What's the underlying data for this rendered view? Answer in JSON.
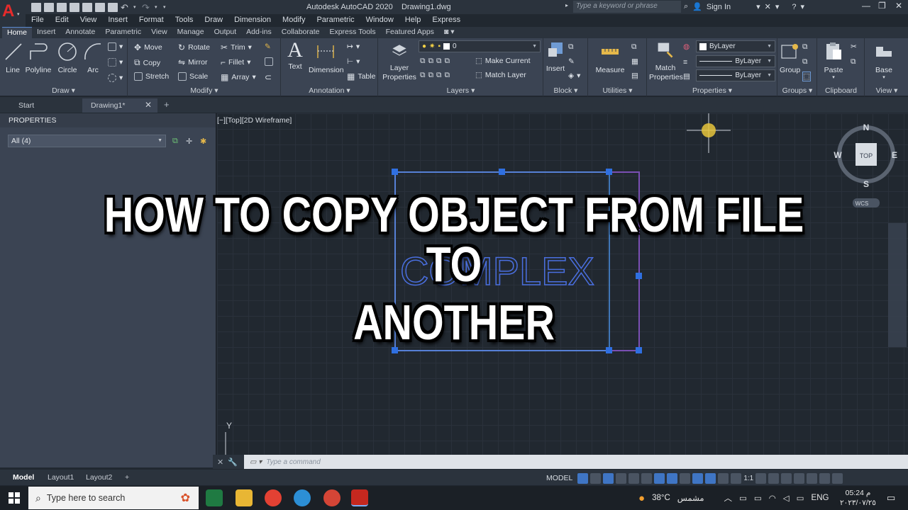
{
  "window": {
    "title": "Autodesk AutoCAD 2020",
    "filename": "Drawing1.dwg",
    "search_placeholder": "Type a keyword or phrase",
    "signin": "Sign In"
  },
  "menubar": [
    "File",
    "Edit",
    "View",
    "Insert",
    "Format",
    "Tools",
    "Draw",
    "Dimension",
    "Modify",
    "Parametric",
    "Window",
    "Help",
    "Express"
  ],
  "ribbon_tabs": [
    "Home",
    "Insert",
    "Annotate",
    "Parametric",
    "View",
    "Manage",
    "Output",
    "Add-ins",
    "Collaborate",
    "Express Tools",
    "Featured Apps"
  ],
  "ribbon": {
    "draw": {
      "label": "Draw",
      "line": "Line",
      "polyline": "Polyline",
      "circle": "Circle",
      "arc": "Arc"
    },
    "modify": {
      "label": "Modify",
      "move": "Move",
      "rotate": "Rotate",
      "trim": "Trim",
      "copy": "Copy",
      "mirror": "Mirror",
      "fillet": "Fillet",
      "stretch": "Stretch",
      "scale": "Scale",
      "array": "Array"
    },
    "annotation": {
      "label": "Annotation",
      "text": "Text",
      "dimension": "Dimension",
      "table": "Table"
    },
    "layers": {
      "label": "Layers",
      "layer_properties_1": "Layer",
      "layer_properties_2": "Properties",
      "current_layer": "0",
      "make_current": "Make Current",
      "match_layer": "Match Layer"
    },
    "block": {
      "label": "Block",
      "insert": "Insert"
    },
    "utilities": {
      "label": "Utilities",
      "measure": "Measure"
    },
    "properties": {
      "label": "Properties",
      "match_1": "Match",
      "match_2": "Properties",
      "color": "ByLayer",
      "linetype": "ByLayer",
      "lineweight": "ByLayer"
    },
    "groups": {
      "label": "Groups",
      "group": "Group"
    },
    "clipboard": {
      "label": "Clipboard",
      "paste": "Paste"
    },
    "view": {
      "label": "View",
      "base": "Base"
    }
  },
  "doc_tabs": {
    "start": "Start",
    "drawing": "Drawing1*"
  },
  "properties_palette": {
    "title": "PROPERTIES",
    "selection": "All (4)"
  },
  "viewport": {
    "label": "[−][Top][2D Wireframe]",
    "drawing_text": "COMPLEX",
    "compass": {
      "n": "N",
      "s": "S",
      "e": "E",
      "w": "W",
      "top": "TOP",
      "wcs": "WCS"
    },
    "ucs_y": "Y"
  },
  "overlay": {
    "line1": "HOW TO COPY OBJECT FROM FILE TO",
    "line2": "ANOTHER"
  },
  "command_line": {
    "placeholder": "Type a command"
  },
  "layout_tabs": {
    "model": "Model",
    "layout1": "Layout1",
    "layout2": "Layout2"
  },
  "status_bar": {
    "model": "MODEL",
    "scale": "1:1"
  },
  "taskbar": {
    "search": "Type here to search",
    "weather_temp": "38°C",
    "weather_desc": "مشمس",
    "lang": "ENG",
    "time": "05:24 م",
    "date": "٢٠٢٣/٠٧/٢٥"
  },
  "colors": {
    "accent": "#3f75c4",
    "ribbon_bg": "#3b4453",
    "canvas_bg": "#212830",
    "selection_blue": "#4a90e2",
    "selection_purple": "#7a4fb3"
  }
}
